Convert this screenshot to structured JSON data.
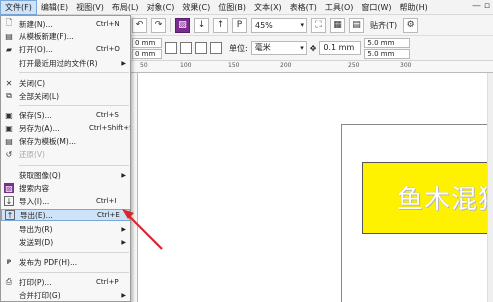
{
  "menubar": {
    "items": [
      {
        "label": "文件(F)"
      },
      {
        "label": "编辑(E)"
      },
      {
        "label": "视图(V)"
      },
      {
        "label": "布局(L)"
      },
      {
        "label": "对象(C)"
      },
      {
        "label": "效果(C)"
      },
      {
        "label": "位图(B)"
      },
      {
        "label": "文本(X)"
      },
      {
        "label": "表格(T)"
      },
      {
        "label": "工具(O)"
      },
      {
        "label": "窗口(W)"
      },
      {
        "label": "帮助(H)"
      }
    ],
    "window_controls": "— ▫"
  },
  "toolbar": {
    "zoom_value": "45%",
    "snap_label": "贴齐(T)",
    "unit_label": "单位:",
    "unit_value": "毫米",
    "nudge_value": "0.1 mm",
    "width_value": "0 mm",
    "height_value": "0 mm",
    "dup_x": "5.0 mm",
    "dup_y": "5.0 mm"
  },
  "ruler": {
    "ticks": [
      "50",
      "100",
      "150",
      "200",
      "250",
      "300"
    ]
  },
  "canvas": {
    "text": "鱼木混猪",
    "box_color": "#fff200"
  },
  "file_menu": {
    "items": [
      {
        "label": "新建(N)...",
        "shortcut": "Ctrl+N",
        "icon": "new-doc-icon",
        "glyph": "🗋"
      },
      {
        "label": "从模板新建(F)...",
        "shortcut": "",
        "icon": "template-icon",
        "glyph": "▤"
      },
      {
        "label": "打开(O)...",
        "shortcut": "Ctrl+O",
        "icon": "open-folder-icon",
        "glyph": "▰"
      },
      {
        "label": "打开最近用过的文件(R)",
        "shortcut": "",
        "icon": "",
        "glyph": "",
        "submenu": true
      },
      {
        "label": "关闭(C)",
        "shortcut": "",
        "icon": "close-doc-icon",
        "glyph": "✕"
      },
      {
        "label": "全部关闭(L)",
        "shortcut": "",
        "icon": "close-all-icon",
        "glyph": "⧉"
      },
      {
        "label": "保存(S)...",
        "shortcut": "Ctrl+S",
        "icon": "save-icon",
        "glyph": "▣"
      },
      {
        "label": "另存为(A)...",
        "shortcut": "Ctrl+Shift+S",
        "icon": "save-as-icon",
        "glyph": "▣"
      },
      {
        "label": "保存为模板(M)...",
        "shortcut": "",
        "icon": "save-template-icon",
        "glyph": "▤"
      },
      {
        "label": "还原(V)",
        "shortcut": "",
        "icon": "revert-icon",
        "glyph": "↺",
        "disabled": true
      },
      {
        "label": "获取图像(Q)",
        "shortcut": "",
        "icon": "",
        "glyph": "",
        "submenu": true
      },
      {
        "label": "搜索内容",
        "shortcut": "",
        "icon": "search-content-icon",
        "glyph": "▨"
      },
      {
        "label": "导入(I)...",
        "shortcut": "Ctrl+I",
        "icon": "import-icon",
        "glyph": "↓"
      },
      {
        "label": "导出(E)...",
        "shortcut": "Ctrl+E",
        "icon": "export-icon",
        "glyph": "↑",
        "highlighted": true
      },
      {
        "label": "导出为(R)",
        "shortcut": "",
        "icon": "",
        "glyph": "",
        "submenu": true
      },
      {
        "label": "发送到(D)",
        "shortcut": "",
        "icon": "",
        "glyph": "",
        "submenu": true
      },
      {
        "label": "发布为 PDF(H)...",
        "shortcut": "",
        "icon": "pdf-icon",
        "glyph": "P"
      },
      {
        "label": "打印(P)...",
        "shortcut": "Ctrl+P",
        "icon": "print-icon",
        "glyph": "⎙"
      },
      {
        "label": "合并打印(G)",
        "shortcut": "",
        "icon": "",
        "glyph": "",
        "submenu": true
      }
    ]
  },
  "annotation_color": "#d8262b"
}
